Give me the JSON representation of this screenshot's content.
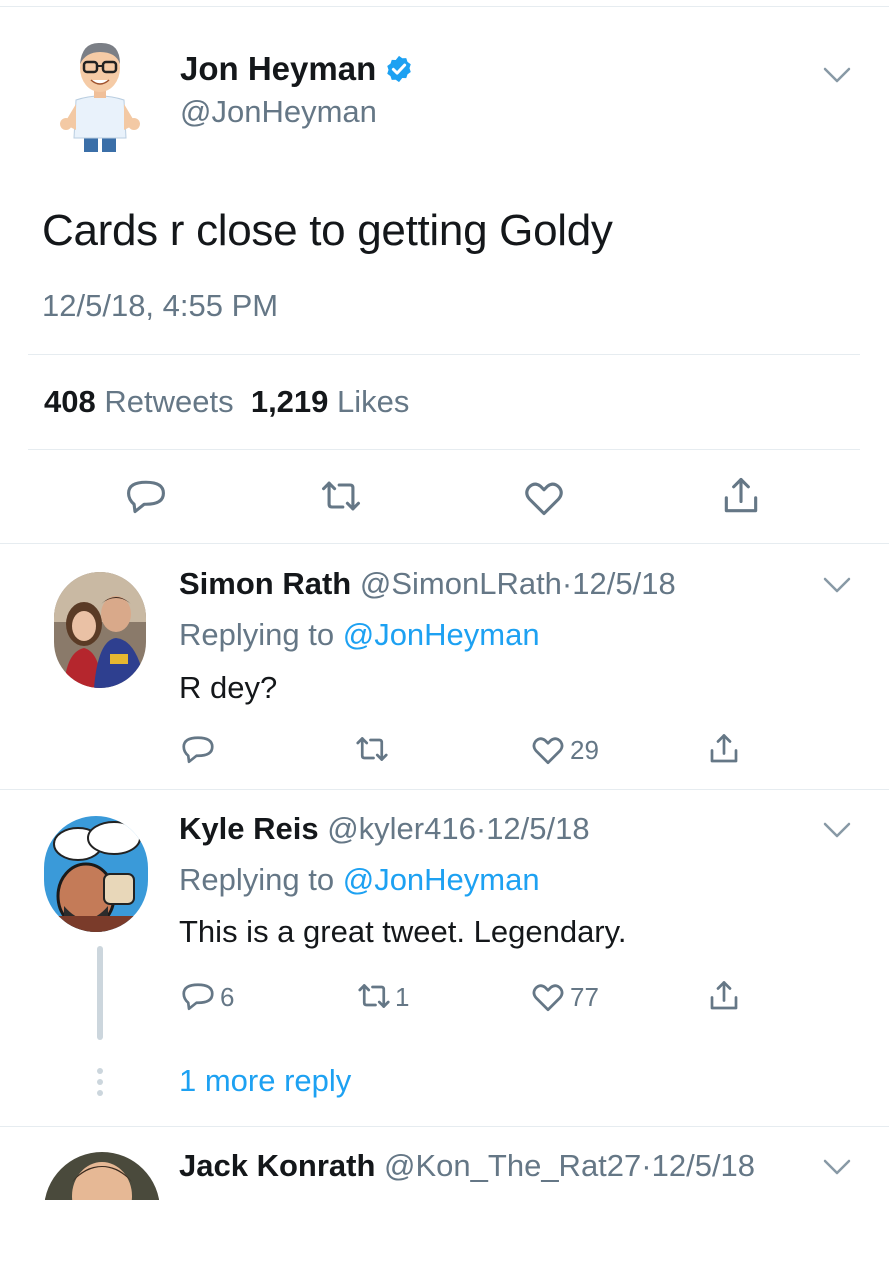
{
  "main_tweet": {
    "name": "Jon Heyman",
    "handle": "@JonHeyman",
    "text": "Cards r close to getting Goldy",
    "timestamp": "12/5/18, 4:55 PM",
    "retweets_count": "408",
    "retweets_label": "Retweets",
    "likes_count": "1,219",
    "likes_label": "Likes"
  },
  "replies": [
    {
      "name": "Simon Rath",
      "handle": "@SimonLRath",
      "date": "12/5/18",
      "replying_prefix": "Replying to ",
      "replying_to": "@JonHeyman",
      "text": "R dey?",
      "replies_count": "",
      "retweets_count": "",
      "likes_count": "29"
    },
    {
      "name": "Kyle Reis",
      "handle": "@kyler416",
      "date": "12/5/18",
      "replying_prefix": "Replying to ",
      "replying_to": "@JonHeyman",
      "text": "This is a great tweet. Legendary.",
      "replies_count": "6",
      "retweets_count": "1",
      "likes_count": "77",
      "more_replies": "1 more reply"
    },
    {
      "name": "Jack Konrath",
      "handle": "@Kon_The_Rat27",
      "date": "12/5/18"
    }
  ],
  "separator": "·",
  "colors": {
    "accent": "#1da1f2",
    "secondary_text": "#657786",
    "divider": "#e6ecf0",
    "icon": "#657786"
  },
  "icons": [
    "chevron-down-icon",
    "verified-badge-icon",
    "reply-icon",
    "retweet-icon",
    "like-icon",
    "share-icon"
  ]
}
